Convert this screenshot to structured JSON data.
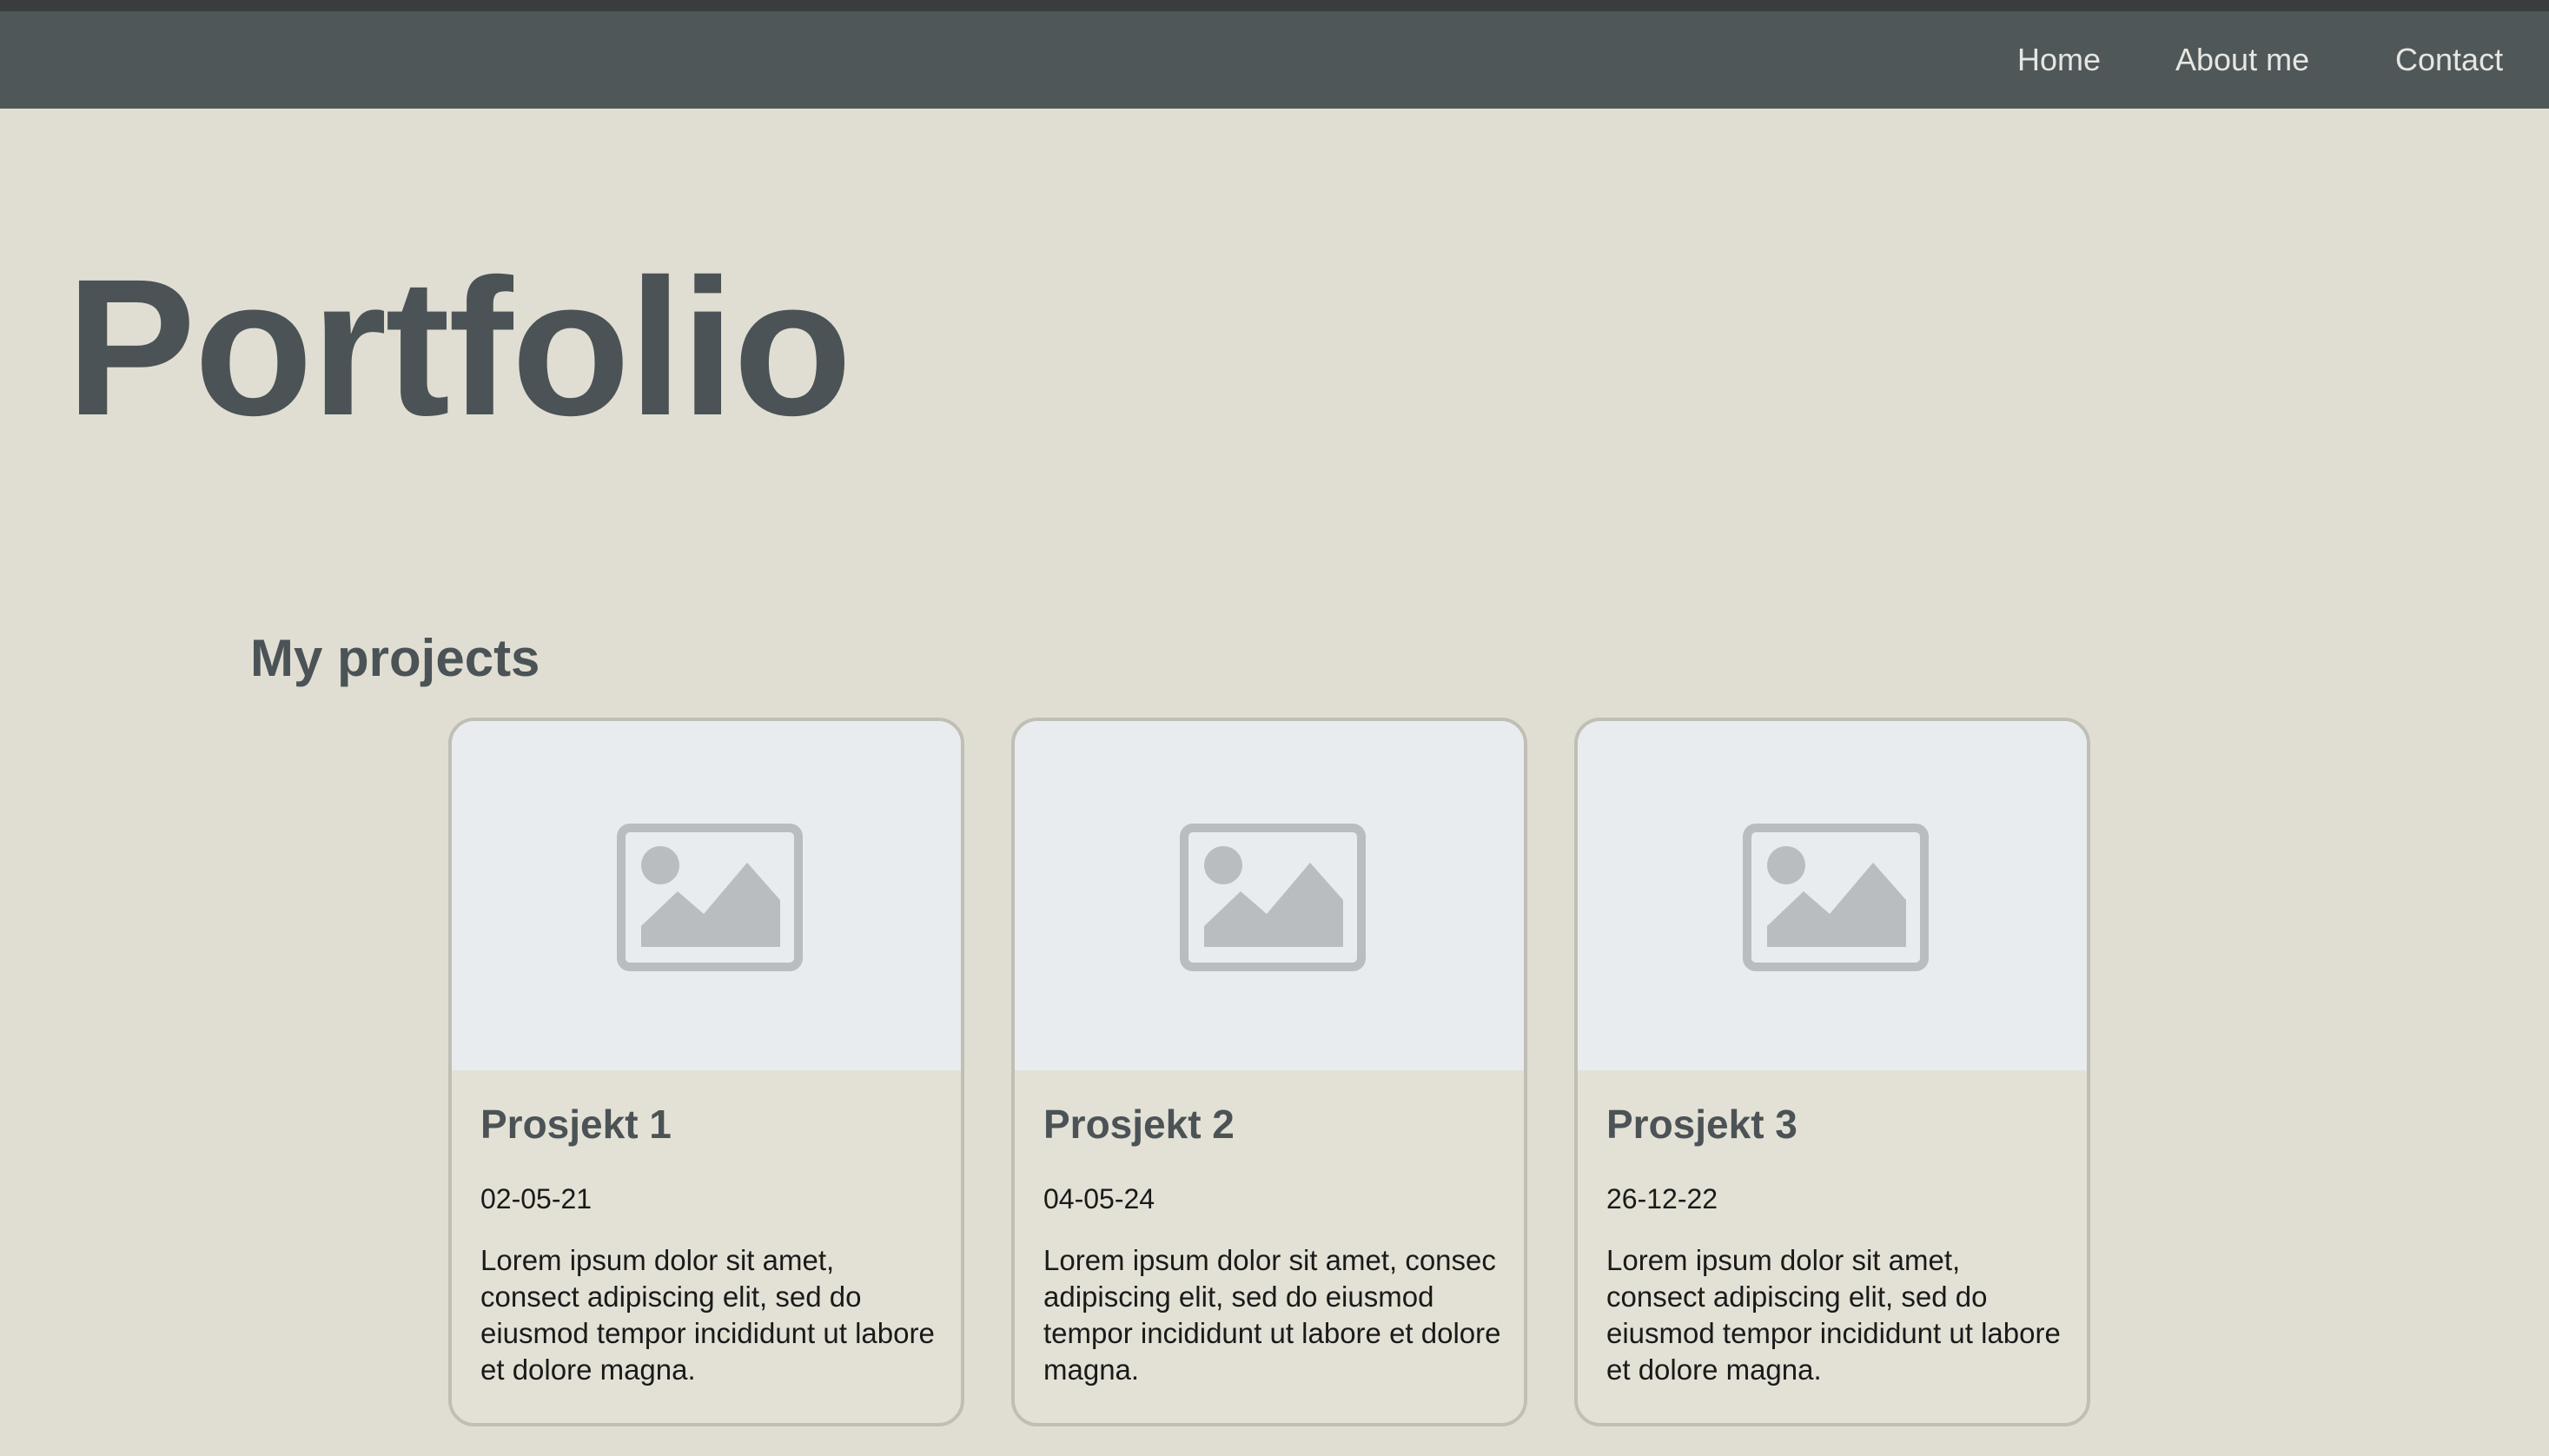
{
  "nav": {
    "items": [
      {
        "label": "Home"
      },
      {
        "label": "About me"
      },
      {
        "label": "Contact"
      }
    ]
  },
  "page": {
    "title": "Portfolio",
    "section_title": "My projects"
  },
  "projects": [
    {
      "title": "Prosjekt 1",
      "date": "02-05-21",
      "description": "Lorem ipsum dolor sit amet, consect adipiscing elit, sed do eiusmod tempor incididunt ut labore et dolore magna.",
      "image_icon": "image-placeholder-icon"
    },
    {
      "title": "Prosjekt 2",
      "date": "04-05-24",
      "description": "Lorem ipsum dolor sit amet, consec adipiscing elit, sed do eiusmod tempor incididunt ut labore et dolore magna.",
      "image_icon": "image-placeholder-icon"
    },
    {
      "title": "Prosjekt 3",
      "date": "26-12-22",
      "description": "Lorem ipsum dolor sit amet, consect adipiscing elit, sed do eiusmod tempor incididunt ut labore et dolore magna.",
      "image_icon": "image-placeholder-icon"
    }
  ],
  "colors": {
    "background": "#e0ded3",
    "navbar": "#4f5759",
    "heading": "#4b5356",
    "card_border": "#c0bfb5",
    "image_area": "#e9ecef",
    "placeholder_icon": "#b9bdc0"
  }
}
